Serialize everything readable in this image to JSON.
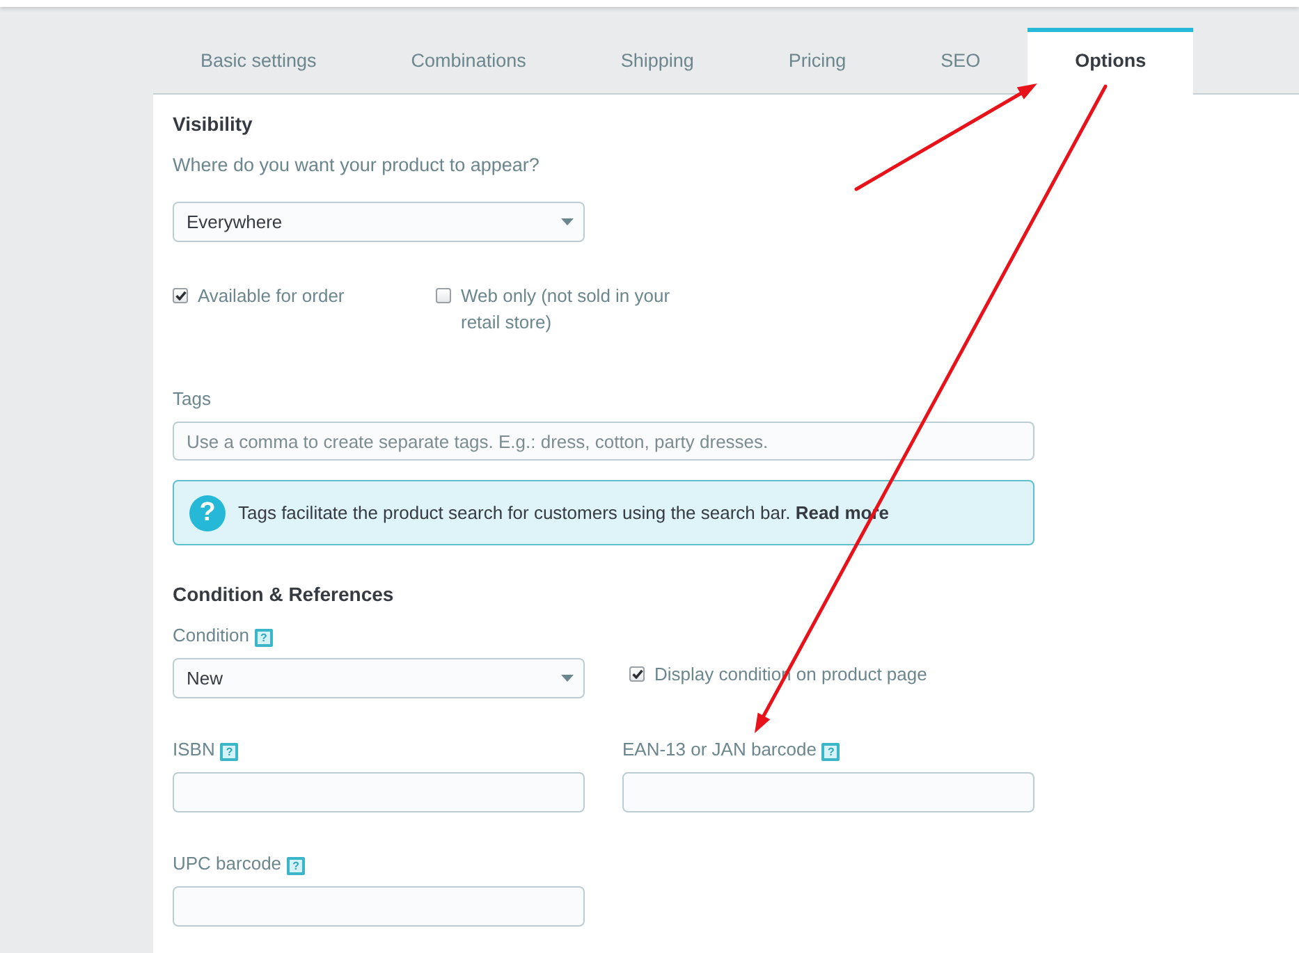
{
  "tabs": [
    {
      "label": "Basic settings",
      "selected": false
    },
    {
      "label": "Combinations",
      "selected": false
    },
    {
      "label": "Shipping",
      "selected": false
    },
    {
      "label": "Pricing",
      "selected": false
    },
    {
      "label": "SEO",
      "selected": false
    },
    {
      "label": "Options",
      "selected": true
    }
  ],
  "visibility": {
    "title": "Visibility",
    "question": "Where do you want your product to appear?",
    "select": {
      "value": "Everywhere"
    },
    "checkboxes": [
      {
        "label": "Available for order",
        "checked": true
      },
      {
        "label": "Web only (not sold in your retail store)",
        "checked": false
      }
    ]
  },
  "tags": {
    "label": "Tags",
    "placeholder": "Use a comma to create separate tags. E.g.: dress, cotton, party dresses.",
    "info": {
      "icon": "?",
      "text": "Tags facilitate the product search for customers using the search bar.",
      "link": "Read more"
    }
  },
  "condition_references": {
    "title": "Condition & References",
    "condition": {
      "label": "Condition",
      "help": "?",
      "value": "New"
    },
    "display_condition": {
      "label": "Display condition on product page",
      "checked": true
    },
    "fields": [
      {
        "label": "ISBN",
        "help": "?"
      },
      {
        "label": "EAN-13 or JAN barcode",
        "help": "?"
      },
      {
        "label": "UPC barcode",
        "help": "?"
      }
    ]
  }
}
